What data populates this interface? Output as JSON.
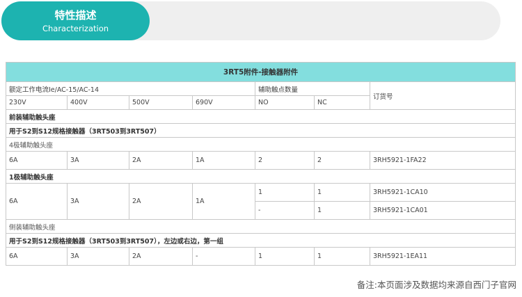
{
  "header": {
    "title_cn": "特性描述",
    "title_en": "Characterization"
  },
  "table": {
    "title": "3RT5附件-接触器附件",
    "col_headers": {
      "rated_current": "额定工作电流Ie/AC-15/AC-14",
      "aux_contacts": "辅助触点数量",
      "order_no": "订货号"
    },
    "voltages": [
      "230V",
      "400V",
      "500V",
      "690V"
    ],
    "contact_types": [
      "NO",
      "NC"
    ],
    "sections": {
      "front_mount": "前装辅助触头座",
      "front_mount_desc": "用于S2到S12规格接触器（3RT503到3RT507）",
      "four_pole": "4极辅助触头座",
      "one_pole": "1极辅助触头座",
      "side_mount": "侧装辅助触头座",
      "side_mount_desc": "用于S2到S12规格接触器（3RT503到3RT507），左边或右边，第一组"
    },
    "rows": {
      "four_pole": {
        "c230": "6A",
        "c400": "3A",
        "c500": "2A",
        "c690": "1A",
        "no": "2",
        "nc": "2",
        "order": "3RH5921-1FA22"
      },
      "one_pole": {
        "c230": "6A",
        "c400": "3A",
        "c500": "2A",
        "c690": "1A",
        "variants": [
          {
            "no": "1",
            "nc": "1",
            "order": "3RH5921-1CA10"
          },
          {
            "no": "-",
            "nc": "1",
            "order": "3RH5921-1CA01"
          }
        ]
      },
      "side_mount": {
        "c230": "6A",
        "c400": "3A",
        "c500": "2A",
        "c690": "-",
        "no": "1",
        "nc": "1",
        "order": "3RH5921-1EA11"
      }
    }
  },
  "footer": {
    "note": "备注:本页面涉及数据均来源自西门子官网"
  }
}
